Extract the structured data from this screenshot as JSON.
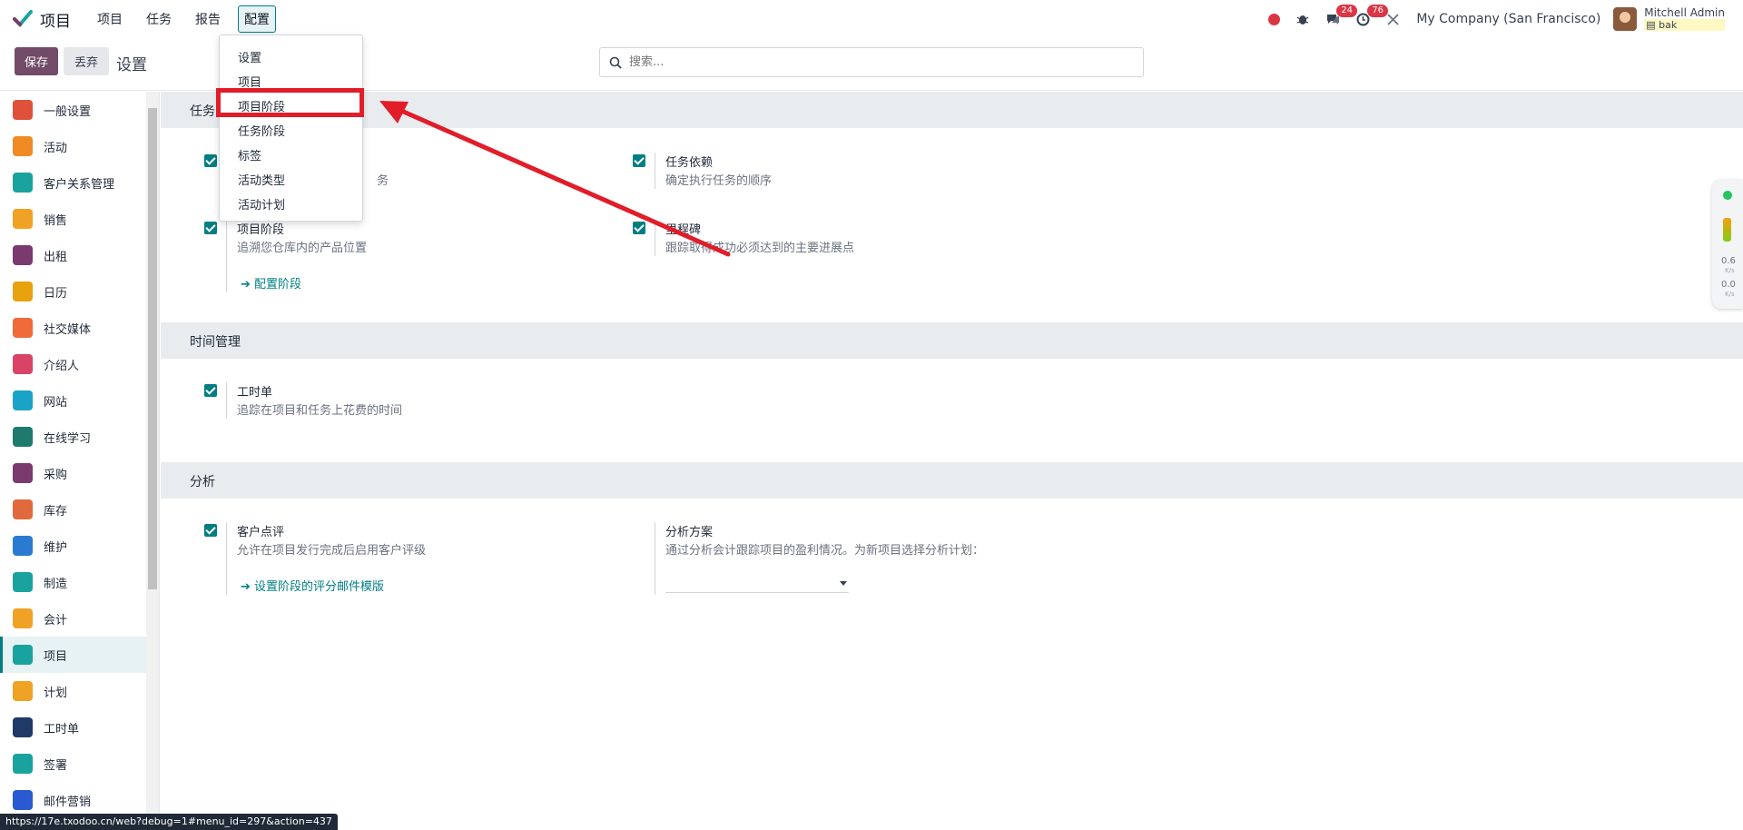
{
  "navbar": {
    "app_title": "项目",
    "menu": [
      "项目",
      "任务",
      "报告",
      "配置"
    ],
    "active_menu": "配置",
    "chat_badge": "24",
    "activity_badge": "76",
    "company": "My Company (San Francisco)",
    "user_name": "Mitchell Admin",
    "user_db": "bak"
  },
  "controlpanel": {
    "save_label": "保存",
    "discard_label": "丢弃",
    "title": "设置",
    "search_placeholder": "搜索..."
  },
  "dropdown": {
    "items": [
      "设置",
      "项目",
      "项目阶段",
      "任务阶段",
      "标签",
      "活动类型",
      "活动计划"
    ],
    "highlighted": "项目阶段"
  },
  "sidebar": {
    "items": [
      {
        "label": "一般设置",
        "icon": "general-settings-icon",
        "color": "#e0513b"
      },
      {
        "label": "活动",
        "icon": "activity-icon",
        "color": "#f08a24"
      },
      {
        "label": "客户关系管理",
        "icon": "crm-icon",
        "color": "#1aa39e"
      },
      {
        "label": "销售",
        "icon": "sales-icon",
        "color": "#f0a224"
      },
      {
        "label": "出租",
        "icon": "rental-icon",
        "color": "#7a3a6e"
      },
      {
        "label": "日历",
        "icon": "calendar-icon",
        "color": "#e8a20e"
      },
      {
        "label": "社交媒体",
        "icon": "social-icon",
        "color": "#f06a3a"
      },
      {
        "label": "介绍人",
        "icon": "referral-icon",
        "color": "#d94466"
      },
      {
        "label": "网站",
        "icon": "website-icon",
        "color": "#1aa3c4"
      },
      {
        "label": "在线学习",
        "icon": "elearning-icon",
        "color": "#1f7a6e"
      },
      {
        "label": "采购",
        "icon": "purchase-icon",
        "color": "#7a3a6e"
      },
      {
        "label": "库存",
        "icon": "inventory-icon",
        "color": "#e06a3b"
      },
      {
        "label": "维护",
        "icon": "maintenance-icon",
        "color": "#2a7ad1"
      },
      {
        "label": "制造",
        "icon": "manufacturing-icon",
        "color": "#1aa39e"
      },
      {
        "label": "会计",
        "icon": "accounting-icon",
        "color": "#f0a224"
      },
      {
        "label": "项目",
        "icon": "project-icon",
        "color": "#1aa39e",
        "active": true
      },
      {
        "label": "计划",
        "icon": "planning-icon",
        "color": "#f0a224"
      },
      {
        "label": "工时单",
        "icon": "timesheet-icon",
        "color": "#1f3a66"
      },
      {
        "label": "签署",
        "icon": "sign-icon",
        "color": "#1aa39e"
      },
      {
        "label": "邮件营销",
        "icon": "mail-marketing-icon",
        "color": "#2a5ad1"
      }
    ]
  },
  "sections": {
    "tasks": {
      "header": "任务",
      "recurring_desc_tail": "务",
      "dependencies_title": "任务依赖",
      "dependencies_desc": "确定执行任务的顺序",
      "stages_title": "项目阶段",
      "stages_desc": "追溯您仓库内的产品位置",
      "stages_link": "配置阶段",
      "milestones_title": "里程碑",
      "milestones_desc": "跟踪取得成功必须达到的主要进展点"
    },
    "time": {
      "header": "时间管理",
      "timesheet_title": "工时单",
      "timesheet_desc": "追踪在项目和任务上花费的时间"
    },
    "analytics": {
      "header": "分析",
      "rating_title": "客户点评",
      "rating_desc": "允许在项目发行完成后启用客户评级",
      "rating_link": "设置阶段的评分邮件模版",
      "plan_title": "分析方案",
      "plan_desc": "通过分析会计跟踪项目的盈利情况。为新项目选择分析计划："
    }
  },
  "net_widget": {
    "up": "0.6",
    "down": "0.0",
    "unit": "K/s"
  },
  "statusbar": {
    "url": "https://17e.txodoo.cn/web?debug=1#menu_id=297&action=437"
  },
  "colors": {
    "accent": "#017e84",
    "brand": "#714b67",
    "annotation": "#e11d2a"
  }
}
